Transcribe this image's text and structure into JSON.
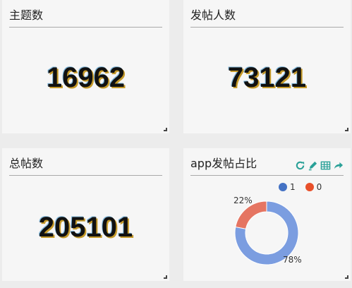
{
  "panels": {
    "topics": {
      "title": "主题数",
      "value": "16962"
    },
    "posters": {
      "title": "发帖人数",
      "value": "73121"
    },
    "posts": {
      "title": "总帖数",
      "value": "205101"
    },
    "app_ratio": {
      "title": "app发帖占比",
      "toolbar": [
        "refresh-icon",
        "edit-icon",
        "table-icon",
        "share-icon"
      ],
      "legend": [
        {
          "label": "1",
          "color": "#4472c4"
        },
        {
          "label": "0",
          "color": "#e8502a"
        }
      ]
    }
  },
  "chart_data": {
    "type": "pie",
    "variant": "donut",
    "title": "app发帖占比",
    "categories": [
      "1",
      "0"
    ],
    "values": [
      78,
      22
    ],
    "labels": [
      "78%",
      "22%"
    ],
    "colors": [
      "#7b9de0",
      "#e57562"
    ],
    "legend_position": "top-right"
  }
}
